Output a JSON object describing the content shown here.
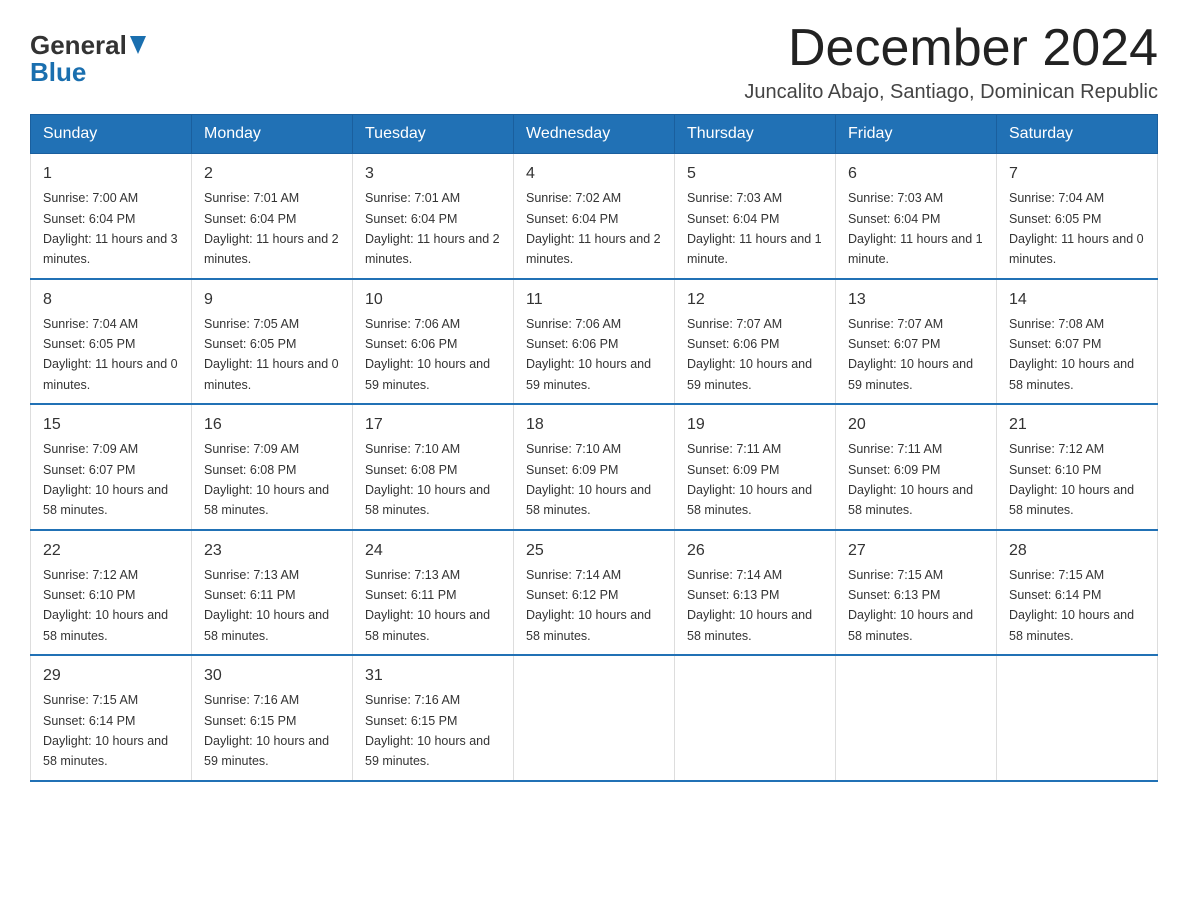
{
  "header": {
    "logo_general": "General",
    "logo_blue": "Blue",
    "month_year": "December 2024",
    "location": "Juncalito Abajo, Santiago, Dominican Republic"
  },
  "weekdays": [
    "Sunday",
    "Monday",
    "Tuesday",
    "Wednesday",
    "Thursday",
    "Friday",
    "Saturday"
  ],
  "weeks": [
    [
      {
        "day": 1,
        "sunrise": "7:00 AM",
        "sunset": "6:04 PM",
        "daylight": "11 hours and 3 minutes."
      },
      {
        "day": 2,
        "sunrise": "7:01 AM",
        "sunset": "6:04 PM",
        "daylight": "11 hours and 2 minutes."
      },
      {
        "day": 3,
        "sunrise": "7:01 AM",
        "sunset": "6:04 PM",
        "daylight": "11 hours and 2 minutes."
      },
      {
        "day": 4,
        "sunrise": "7:02 AM",
        "sunset": "6:04 PM",
        "daylight": "11 hours and 2 minutes."
      },
      {
        "day": 5,
        "sunrise": "7:03 AM",
        "sunset": "6:04 PM",
        "daylight": "11 hours and 1 minute."
      },
      {
        "day": 6,
        "sunrise": "7:03 AM",
        "sunset": "6:04 PM",
        "daylight": "11 hours and 1 minute."
      },
      {
        "day": 7,
        "sunrise": "7:04 AM",
        "sunset": "6:05 PM",
        "daylight": "11 hours and 0 minutes."
      }
    ],
    [
      {
        "day": 8,
        "sunrise": "7:04 AM",
        "sunset": "6:05 PM",
        "daylight": "11 hours and 0 minutes."
      },
      {
        "day": 9,
        "sunrise": "7:05 AM",
        "sunset": "6:05 PM",
        "daylight": "11 hours and 0 minutes."
      },
      {
        "day": 10,
        "sunrise": "7:06 AM",
        "sunset": "6:06 PM",
        "daylight": "10 hours and 59 minutes."
      },
      {
        "day": 11,
        "sunrise": "7:06 AM",
        "sunset": "6:06 PM",
        "daylight": "10 hours and 59 minutes."
      },
      {
        "day": 12,
        "sunrise": "7:07 AM",
        "sunset": "6:06 PM",
        "daylight": "10 hours and 59 minutes."
      },
      {
        "day": 13,
        "sunrise": "7:07 AM",
        "sunset": "6:07 PM",
        "daylight": "10 hours and 59 minutes."
      },
      {
        "day": 14,
        "sunrise": "7:08 AM",
        "sunset": "6:07 PM",
        "daylight": "10 hours and 58 minutes."
      }
    ],
    [
      {
        "day": 15,
        "sunrise": "7:09 AM",
        "sunset": "6:07 PM",
        "daylight": "10 hours and 58 minutes."
      },
      {
        "day": 16,
        "sunrise": "7:09 AM",
        "sunset": "6:08 PM",
        "daylight": "10 hours and 58 minutes."
      },
      {
        "day": 17,
        "sunrise": "7:10 AM",
        "sunset": "6:08 PM",
        "daylight": "10 hours and 58 minutes."
      },
      {
        "day": 18,
        "sunrise": "7:10 AM",
        "sunset": "6:09 PM",
        "daylight": "10 hours and 58 minutes."
      },
      {
        "day": 19,
        "sunrise": "7:11 AM",
        "sunset": "6:09 PM",
        "daylight": "10 hours and 58 minutes."
      },
      {
        "day": 20,
        "sunrise": "7:11 AM",
        "sunset": "6:09 PM",
        "daylight": "10 hours and 58 minutes."
      },
      {
        "day": 21,
        "sunrise": "7:12 AM",
        "sunset": "6:10 PM",
        "daylight": "10 hours and 58 minutes."
      }
    ],
    [
      {
        "day": 22,
        "sunrise": "7:12 AM",
        "sunset": "6:10 PM",
        "daylight": "10 hours and 58 minutes."
      },
      {
        "day": 23,
        "sunrise": "7:13 AM",
        "sunset": "6:11 PM",
        "daylight": "10 hours and 58 minutes."
      },
      {
        "day": 24,
        "sunrise": "7:13 AM",
        "sunset": "6:11 PM",
        "daylight": "10 hours and 58 minutes."
      },
      {
        "day": 25,
        "sunrise": "7:14 AM",
        "sunset": "6:12 PM",
        "daylight": "10 hours and 58 minutes."
      },
      {
        "day": 26,
        "sunrise": "7:14 AM",
        "sunset": "6:13 PM",
        "daylight": "10 hours and 58 minutes."
      },
      {
        "day": 27,
        "sunrise": "7:15 AM",
        "sunset": "6:13 PM",
        "daylight": "10 hours and 58 minutes."
      },
      {
        "day": 28,
        "sunrise": "7:15 AM",
        "sunset": "6:14 PM",
        "daylight": "10 hours and 58 minutes."
      }
    ],
    [
      {
        "day": 29,
        "sunrise": "7:15 AM",
        "sunset": "6:14 PM",
        "daylight": "10 hours and 58 minutes."
      },
      {
        "day": 30,
        "sunrise": "7:16 AM",
        "sunset": "6:15 PM",
        "daylight": "10 hours and 59 minutes."
      },
      {
        "day": 31,
        "sunrise": "7:16 AM",
        "sunset": "6:15 PM",
        "daylight": "10 hours and 59 minutes."
      },
      null,
      null,
      null,
      null
    ]
  ]
}
